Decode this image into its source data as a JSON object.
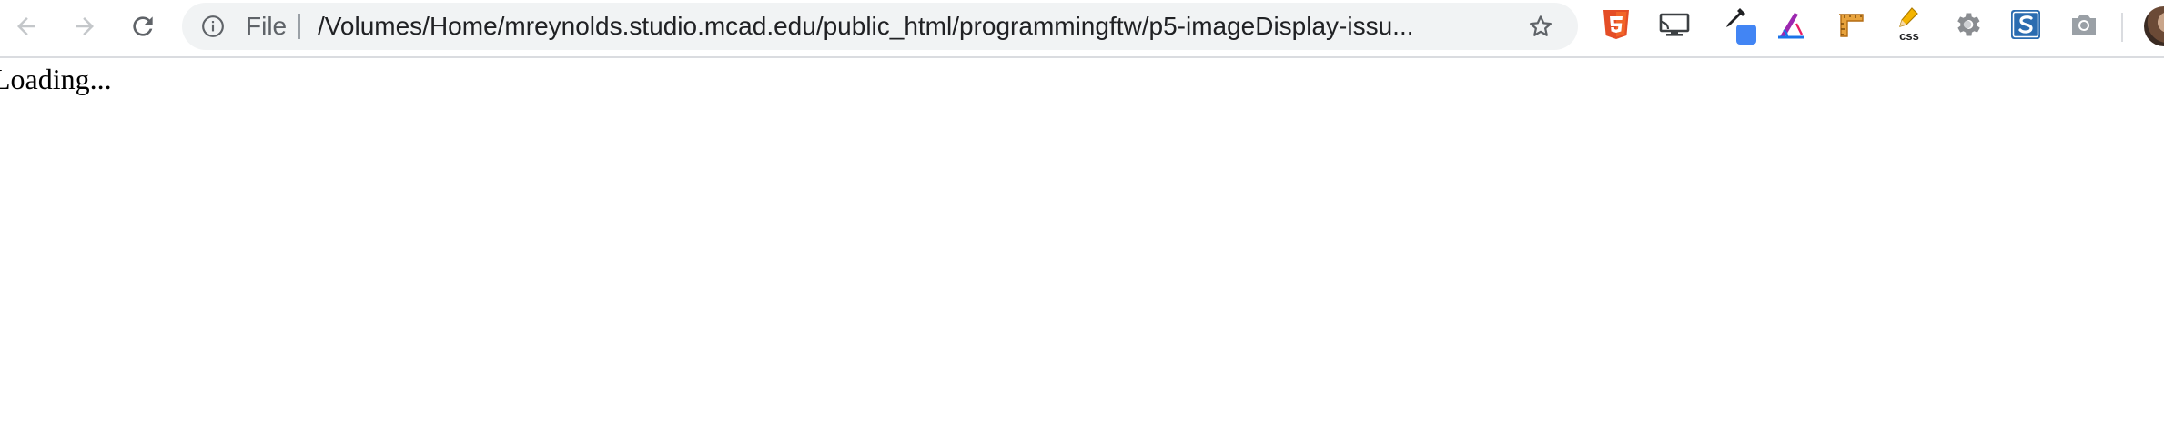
{
  "browser": {
    "omnibox": {
      "scheme_label": "File",
      "url": "/Volumes/Home/mreynolds.studio.mcad.edu/public_html/programmingftw/p5-imageDisplay-issu..."
    },
    "icons": {
      "back": "arrow-left-icon",
      "forward": "arrow-right-icon",
      "reload": "reload-icon",
      "info": "info-icon",
      "bookmark": "star-icon"
    },
    "extensions": [
      "html5-extension-icon",
      "cast-extension-icon",
      "eyedropper-extension-icon",
      "geometry-extension-icon",
      "ruler-extension-icon",
      "css-pencil-extension-icon",
      "gear-extension-icon",
      "s-extension-icon",
      "camera-extension-icon"
    ],
    "extension_labels": {
      "css": "css"
    },
    "colors": {
      "toolbar_bg": "#ffffff",
      "omnibox_bg": "#f1f3f4",
      "icon_gray": "#5f6368",
      "html5_orange": "#e44d26",
      "eyedropper_blue": "#4285f4"
    }
  },
  "page": {
    "body_text": "Loading..."
  }
}
